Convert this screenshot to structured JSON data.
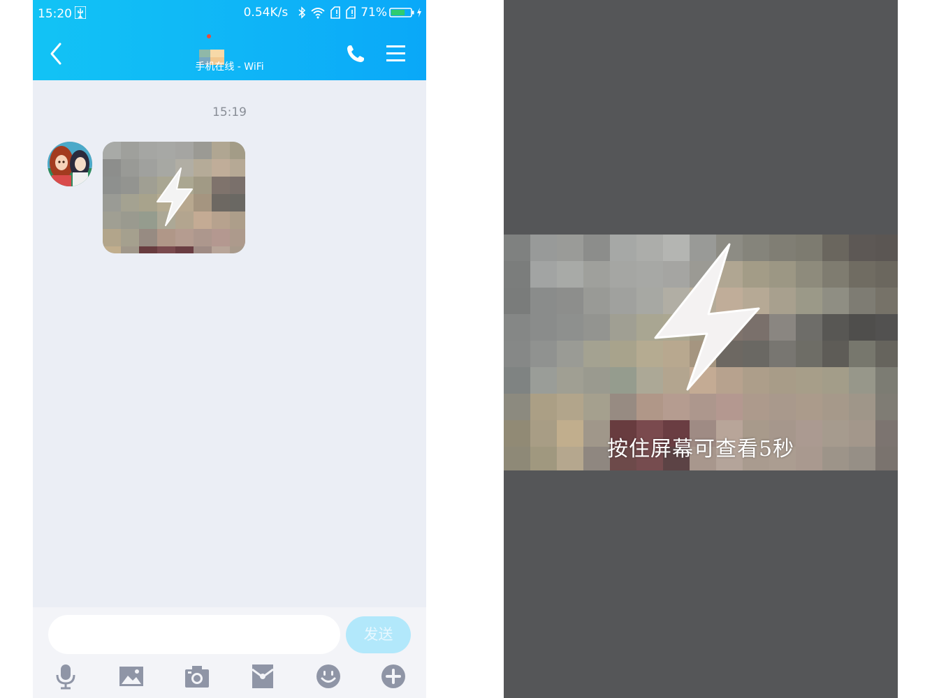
{
  "status_bar": {
    "time": "15:20",
    "net_speed": "0.54K/s",
    "battery_percent": "71%",
    "battery_level": 0.71,
    "icons": [
      "usb-icon",
      "bluetooth-icon",
      "wifi-icon",
      "signal-icon",
      "signal-icon",
      "battery-icon",
      "charging-icon"
    ]
  },
  "header": {
    "subtitle": "手机在线 - WiFi",
    "back_icon": "chevron-left-icon",
    "call_icon": "phone-icon",
    "menu_icon": "hamburger-menu-icon",
    "background_color": "#12c3f5"
  },
  "chat": {
    "timestamp": "15:19",
    "message_type": "flash-image",
    "message_icon": "lightning-bolt-icon"
  },
  "input_bar": {
    "placeholder": "",
    "send_label": "发送",
    "toolbar_icons": [
      "microphone-icon",
      "image-icon",
      "camera-icon",
      "red-packet-icon",
      "emoji-icon",
      "plus-icon"
    ]
  },
  "preview": {
    "hint": "按住屏幕可查看5秒",
    "icon": "lightning-bolt-icon",
    "overlay_color": "#555658"
  }
}
